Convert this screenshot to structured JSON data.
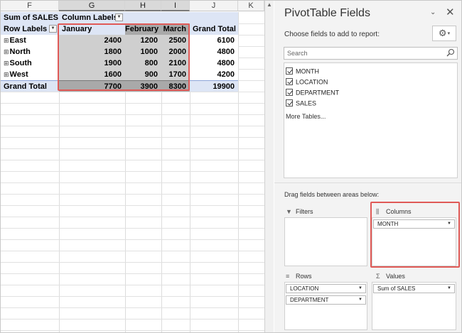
{
  "sheet": {
    "columns": [
      "F",
      "G",
      "H",
      "I",
      "J",
      "K"
    ],
    "selected_columns": [
      "G",
      "H",
      "I"
    ],
    "pivot": {
      "sum_label": "Sum of SALES",
      "column_labels": "Column Labels",
      "row_labels": "Row Labels",
      "months": [
        "January",
        "February",
        "March"
      ],
      "grand_total_label": "Grand Total",
      "expand_glyph": "⊞",
      "rows": [
        {
          "label": "East",
          "values": [
            "2400",
            "1200",
            "2500"
          ],
          "total": "6100"
        },
        {
          "label": "North",
          "values": [
            "1800",
            "1000",
            "2000"
          ],
          "total": "4800"
        },
        {
          "label": "South",
          "values": [
            "1900",
            "800",
            "2100"
          ],
          "total": "4800"
        },
        {
          "label": "West",
          "values": [
            "1600",
            "900",
            "1700"
          ],
          "total": "4200"
        }
      ],
      "grand_values": [
        "7700",
        "3900",
        "8300"
      ],
      "grand_total": "19900"
    }
  },
  "pane": {
    "title": "PivotTable Fields",
    "dropdown_glyph": "⌄",
    "close_glyph": "✕",
    "choose_label": "Choose fields to add to report:",
    "gear_icon": "⚙",
    "gear_dd": "▾",
    "search_placeholder": "Search",
    "fields": [
      "MONTH",
      "LOCATION",
      "DEPARTMENT",
      "SALES"
    ],
    "more_tables": "More Tables...",
    "drag_label": "Drag fields between areas below:",
    "areas": {
      "filters": {
        "title": "Filters",
        "icon": "filter-icon",
        "glyph": "▼",
        "items": []
      },
      "columns": {
        "title": "Columns",
        "icon": "columns-icon",
        "glyph": "⫼",
        "items": [
          "MONTH"
        ]
      },
      "rows": {
        "title": "Rows",
        "icon": "rows-icon",
        "glyph": "≡",
        "items": [
          "LOCATION",
          "DEPARTMENT"
        ]
      },
      "values": {
        "title": "Values",
        "icon": "sigma-icon",
        "glyph": "Σ",
        "items": [
          "Sum of SALES"
        ]
      }
    },
    "pill_dd": "▼"
  },
  "colors": {
    "highlight": "#e05a57",
    "pivot_header": "#dde5f5",
    "gray_cell": "#cfcfcf",
    "dark_gray_cell": "#a9a9a9"
  }
}
